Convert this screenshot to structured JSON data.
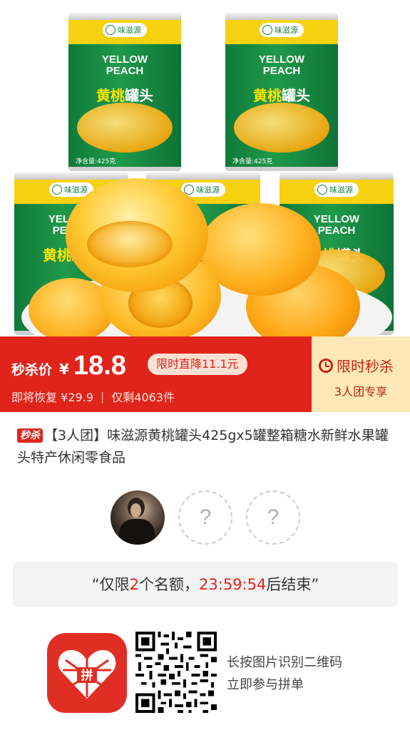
{
  "hero": {
    "can_brand": "味滋源",
    "can_english": [
      "YELLOW",
      "PEACH"
    ],
    "can_chinese_highlight": "黄桃",
    "can_chinese_rest": "罐头",
    "can_net_weight": "净含量:425克"
  },
  "banner": {
    "price_label": "秒杀价",
    "currency": "¥",
    "price": "18.8",
    "drop_pill": "限时直降11.1元",
    "restore_text": "即将恢复 ¥29.9",
    "stock_text": "仅剩4063件",
    "flash_label": "限时秒杀",
    "group_note": "3人团专享"
  },
  "product": {
    "tag": "秒杀",
    "title": "【3人团】味滋源黄桃罐头425gx5罐整箱糖水新鲜水果罐头特产休闲零食品"
  },
  "group": {
    "empty_slot_symbol": "?"
  },
  "countdown": {
    "open_quote": "“仅限",
    "slots": "2",
    "mid": "个名额，",
    "time": "23:59:54",
    "suffix": "后结束”"
  },
  "footer": {
    "app_logo_text": "拼",
    "scan_line1": "长按图片识别二维码",
    "scan_line2": "立即参与拼单"
  },
  "colors": {
    "brand_red": "#e0241b",
    "flash_bg": "#ffe8b8",
    "can_green": "#1f9a4a",
    "can_yellow": "#f6d10f"
  },
  "icons": [
    "clock-icon",
    "question-mark-icon",
    "pinduoduo-app-icon",
    "qr-code"
  ]
}
